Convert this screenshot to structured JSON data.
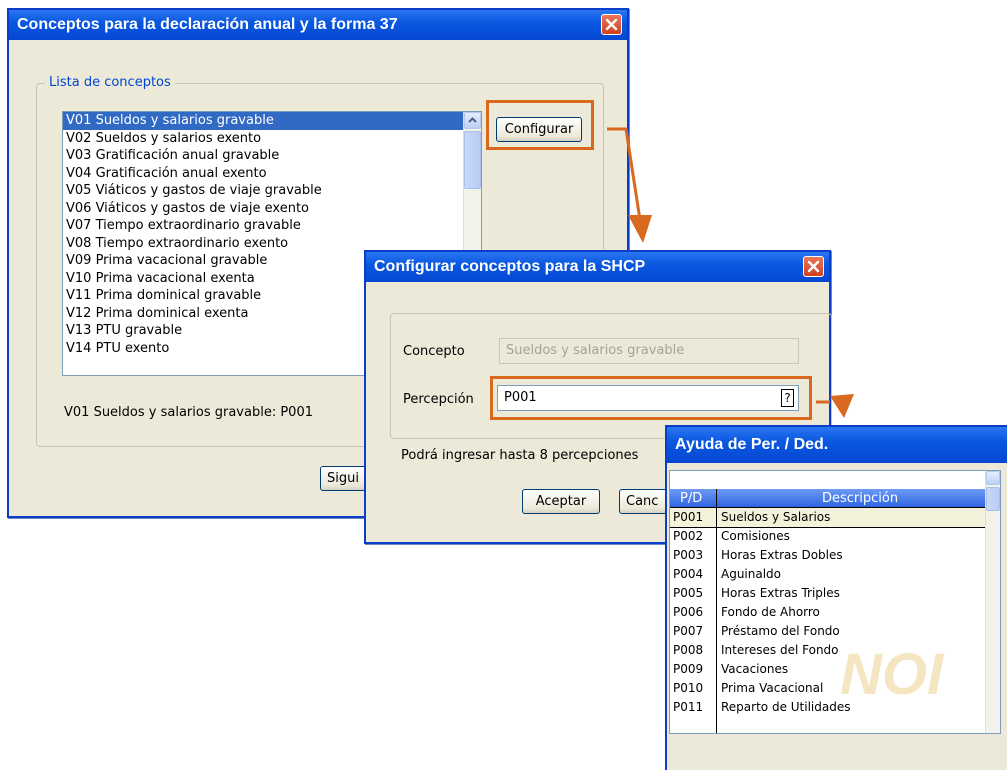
{
  "window1": {
    "title": "Conceptos para la declaración anual y la forma 37",
    "group_label": "Lista de conceptos",
    "items": [
      "V01 Sueldos y salarios gravable",
      "V02 Sueldos y salarios exento",
      "V03 Gratificación anual gravable",
      "V04 Gratificación anual exento",
      "V05 Viáticos y gastos de viaje gravable",
      "V06 Viáticos y gastos de viaje exento",
      "V07 Tiempo extraordinario gravable",
      "V08 Tiempo extraordinario exento",
      "V09 Prima vacacional gravable",
      "V10 Prima vacacional exenta",
      "V11 Prima dominical gravable",
      "V12 Prima dominical exenta",
      "V13 PTU gravable",
      "V14 PTU exento"
    ],
    "configure_label": "Configurar",
    "summary": "V01 Sueldos y salarios gravable: P001",
    "next_label": "Sigui"
  },
  "window2": {
    "title": "Configurar conceptos para la SHCP",
    "concept_label": "Concepto",
    "concept_value": "Sueldos y salarios gravable",
    "perception_label": "Percepción",
    "perception_value": "P001",
    "help_glyph": "?",
    "note": "Podrá ingresar hasta 8 percepciones",
    "accept_label": "Aceptar",
    "cancel_label": "Canc"
  },
  "window3": {
    "title": "Ayuda de Per. / Ded.",
    "col_code": "P/D",
    "col_desc": "Descripción",
    "rows": [
      {
        "code": "P001",
        "desc": "Sueldos y Salarios"
      },
      {
        "code": "P002",
        "desc": "Comisiones"
      },
      {
        "code": "P003",
        "desc": "Horas Extras Dobles"
      },
      {
        "code": "P004",
        "desc": "Aguinaldo"
      },
      {
        "code": "P005",
        "desc": "Horas Extras Triples"
      },
      {
        "code": "P006",
        "desc": "Fondo de Ahorro"
      },
      {
        "code": "P007",
        "desc": "Préstamo del Fondo"
      },
      {
        "code": "P008",
        "desc": "Intereses del Fondo"
      },
      {
        "code": "P009",
        "desc": "Vacaciones"
      },
      {
        "code": "P010",
        "desc": "Prima Vacacional"
      },
      {
        "code": "P011",
        "desc": "Reparto de Utilidades"
      }
    ],
    "watermark": "NOI"
  },
  "colors": {
    "title_bar": "#0a58e0",
    "highlight": "#d8691f",
    "selection": "#316ac5",
    "group_label": "#0046d5"
  }
}
